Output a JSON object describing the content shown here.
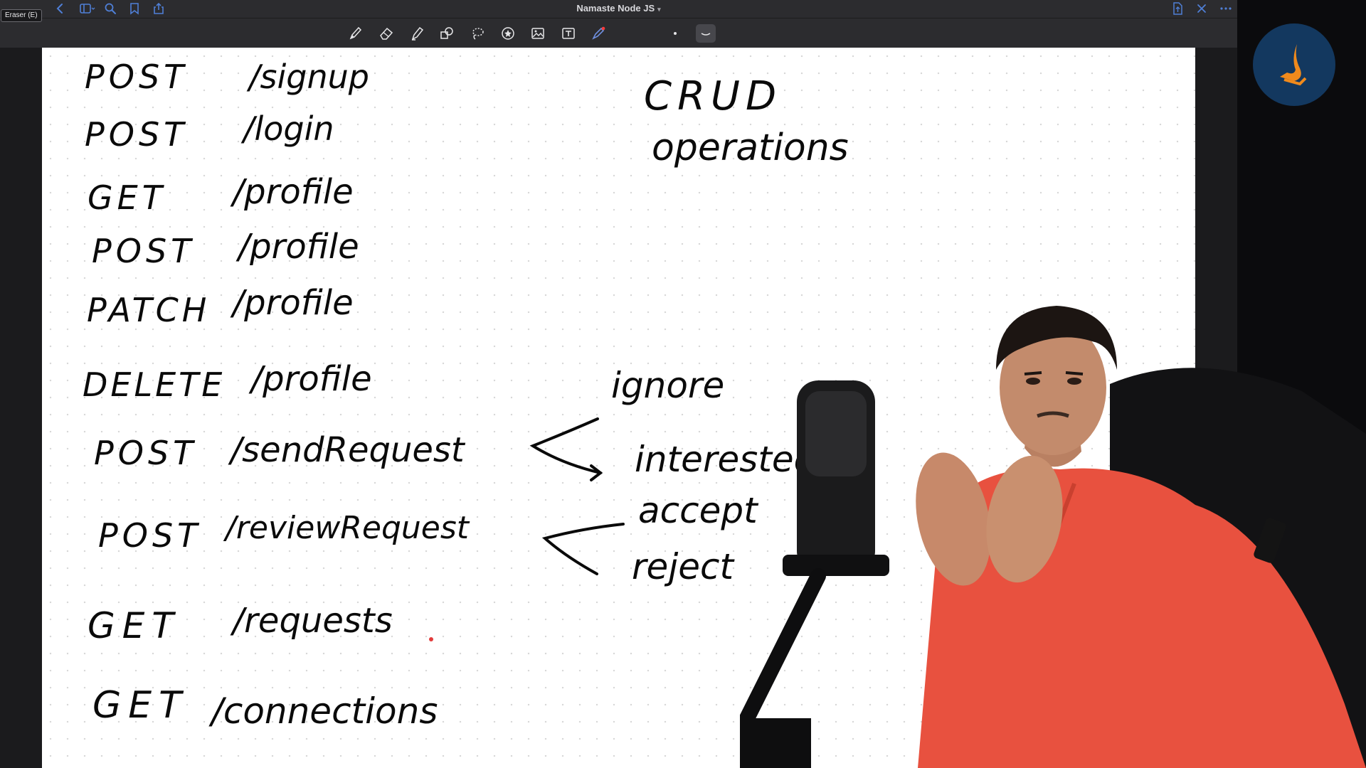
{
  "window": {
    "title": "Namaste Node JS",
    "tooltip": "Eraser (E)"
  },
  "titlebar_icons": [
    "back-icon",
    "sidebar-toggle-icon",
    "search-icon",
    "bookmark-icon",
    "share-icon",
    "export-icon",
    "close-icon",
    "more-icon"
  ],
  "toolbar": {
    "tools": [
      "pen-icon",
      "eraser-icon",
      "highlighter-icon",
      "shapes-icon",
      "lasso-icon",
      "sticker-icon",
      "image-icon",
      "text-icon",
      "laser-pointer-icon"
    ],
    "active_tool": "eraser-icon"
  },
  "notes": {
    "routes": [
      {
        "method": "POST",
        "path": "/signup"
      },
      {
        "method": "POST",
        "path": "/login"
      },
      {
        "method": "GET",
        "path": "/profile"
      },
      {
        "method": "POST",
        "path": "/profile"
      },
      {
        "method": "PATCH",
        "path": "/profile"
      },
      {
        "method": "DELETE",
        "path": "/profile"
      },
      {
        "method": "POST",
        "path": "/sendRequest"
      },
      {
        "method": "POST",
        "path": "/reviewRequest"
      },
      {
        "method": "GET",
        "path": "/requests"
      },
      {
        "method": "GET",
        "path": "/connections"
      }
    ],
    "crud_title": "CRUD",
    "crud_subtitle": "operations",
    "send_options": [
      "ignore",
      "interested"
    ],
    "review_options": [
      "accept",
      "reject"
    ]
  },
  "colors": {
    "ink": "#0a0a0a",
    "chrome": "#2c2c2f",
    "logo_bg": "#13385f",
    "logo_accent": "#f08a1c",
    "shirt": "#e8513f"
  }
}
